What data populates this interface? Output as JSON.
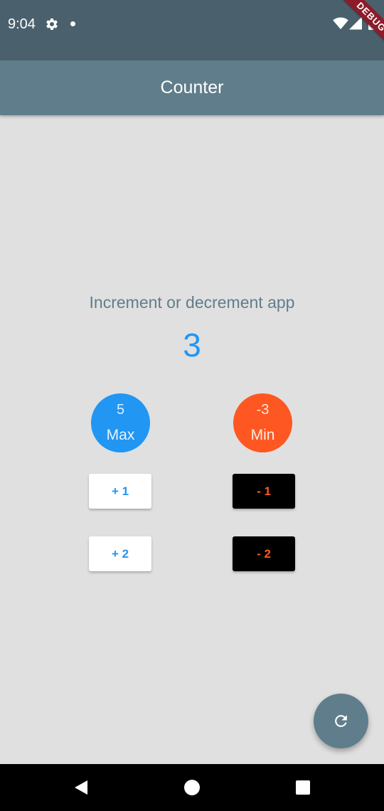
{
  "status_bar": {
    "time": "9:04",
    "debug_banner": "DEBUG",
    "icons": [
      "gear-icon",
      "dot-icon",
      "wifi-icon",
      "signal-icon",
      "battery-icon"
    ]
  },
  "app_bar": {
    "title": "Counter"
  },
  "main": {
    "subtitle": "Increment or decrement app",
    "counter_value": "3",
    "max": {
      "value": "5",
      "label": "Max"
    },
    "min": {
      "value": "-3",
      "label": "Min"
    },
    "buttons": {
      "plus_one": "+ 1",
      "minus_one": "- 1",
      "plus_two": "+ 2",
      "minus_two": "- 2"
    }
  },
  "fab": {
    "icon": "refresh-icon"
  },
  "nav_bar": {
    "icons": [
      "back-icon",
      "home-icon",
      "recent-apps-icon"
    ]
  },
  "colors": {
    "status_bar": "#4a616d",
    "app_bar": "#607d8b",
    "background": "#e0e0e0",
    "blue": "#2196f3",
    "deep_orange": "#ff5722",
    "debug_ribbon": "#8e1b2a"
  }
}
